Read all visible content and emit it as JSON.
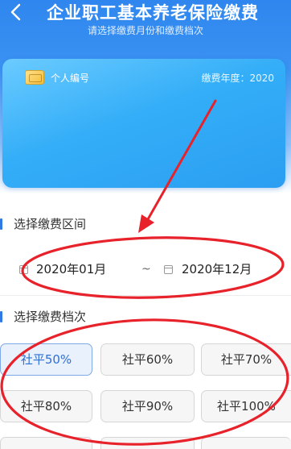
{
  "header": {
    "title": "企业职工基本养老保险缴费",
    "subtitle": "请选择缴费月份和缴费档次"
  },
  "card": {
    "personal_id_label": "个人编号",
    "year_label": "缴费年度：2020"
  },
  "period_section": {
    "title": "选择缴费区间",
    "start": "2020年01月",
    "separator": "~",
    "end": "2020年12月"
  },
  "level_section": {
    "title": "选择缴费档次",
    "levels": [
      "社平50%",
      "社平60%",
      "社平70%",
      "社平80%",
      "社平90%",
      "社平100%"
    ],
    "selected": "社平50%"
  },
  "colors": {
    "header_blue": "#2f86ee",
    "card_blue": "#34aef8",
    "accent": "#2f7ae5",
    "annotation_red": "#e8222a"
  }
}
